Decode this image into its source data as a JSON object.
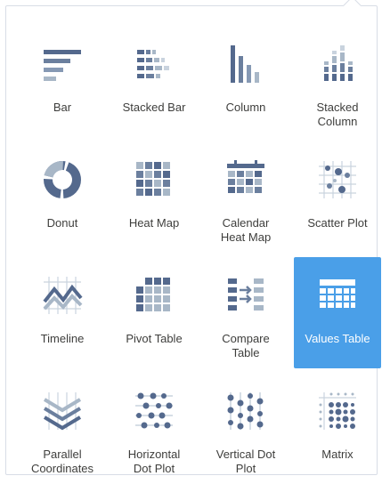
{
  "colors": {
    "icon": "#54698d",
    "icon_light": "#a8b7c7",
    "selected_bg": "#4a9fe8",
    "label": "#3e3e3c"
  },
  "charts": [
    {
      "label": "Bar",
      "icon": "bar-chart-icon",
      "selected": false
    },
    {
      "label": "Stacked Bar",
      "icon": "stacked-bar-chart-icon",
      "selected": false
    },
    {
      "label": "Column",
      "icon": "column-chart-icon",
      "selected": false
    },
    {
      "label": "Stacked\nColumn",
      "icon": "stacked-column-chart-icon",
      "selected": false
    },
    {
      "label": "Donut",
      "icon": "donut-chart-icon",
      "selected": false
    },
    {
      "label": "Heat Map",
      "icon": "heat-map-icon",
      "selected": false
    },
    {
      "label": "Calendar\nHeat Map",
      "icon": "calendar-heat-map-icon",
      "selected": false
    },
    {
      "label": "Scatter Plot",
      "icon": "scatter-plot-icon",
      "selected": false
    },
    {
      "label": "Timeline",
      "icon": "timeline-icon",
      "selected": false
    },
    {
      "label": "Pivot Table",
      "icon": "pivot-table-icon",
      "selected": false
    },
    {
      "label": "Compare\nTable",
      "icon": "compare-table-icon",
      "selected": false
    },
    {
      "label": "Values Table",
      "icon": "values-table-icon",
      "selected": true
    },
    {
      "label": "Parallel\nCoordinates",
      "icon": "parallel-coordinates-icon",
      "selected": false
    },
    {
      "label": "Horizontal\nDot Plot",
      "icon": "horizontal-dot-plot-icon",
      "selected": false
    },
    {
      "label": "Vertical Dot\nPlot",
      "icon": "vertical-dot-plot-icon",
      "selected": false
    },
    {
      "label": "Matrix",
      "icon": "matrix-icon",
      "selected": false
    }
  ]
}
